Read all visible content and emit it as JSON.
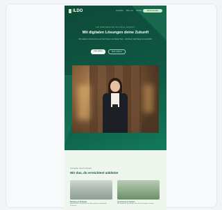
{
  "header": {
    "logo": "ILDO",
    "nav_links": [
      "Angebote",
      "Über uns",
      "Kontakt"
    ],
    "cta": "Termin buchen"
  },
  "hero": {
    "eyebrow": "IHR PARTNER FÜR DIGITALE ZUKUNFT",
    "headline": "Mit digitalen Lösungen deine Zukunft",
    "subline": "Wir begleiten Unternehmen auf dem Weg in die digitale Welt – individuell, nachhaltig und persönlich.",
    "primary_button": "Jetzt starten",
    "secondary_button": "Mehr erfahren"
  },
  "section": {
    "eyebrow": "UNSERE LEISTUNGEN",
    "title": "Wir das, du erreichtest ankleine",
    "features": [
      {
        "title": "Beratung & Strategie",
        "text": "Individuelle Konzepte für Ihr Unternehmen und digitale Prozesse."
      },
      {
        "title": "Umsetzung & Support",
        "text": "Wir begleiten Sie von der Idee bis zur fertigen Lösung."
      }
    ]
  }
}
